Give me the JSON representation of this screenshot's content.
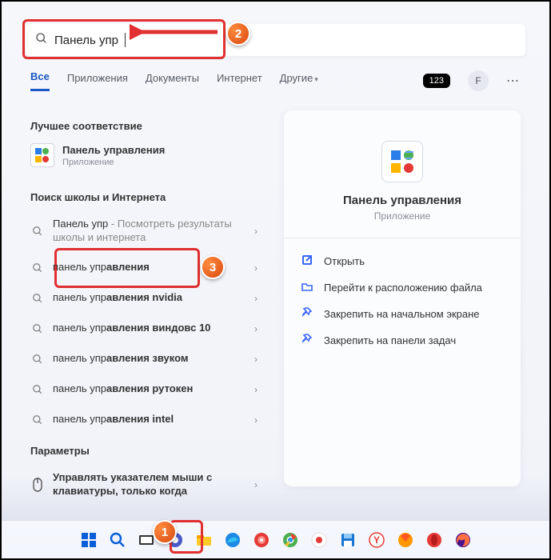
{
  "search": {
    "value": "Панель упр"
  },
  "tabs": {
    "items": [
      "Все",
      "Приложения",
      "Документы",
      "Интернет",
      "Другие"
    ],
    "active_index": 0
  },
  "badges": {
    "pill": "123",
    "avatar": "F"
  },
  "left": {
    "best_header": "Лучшее соответствие",
    "best": {
      "title": "Панель управления",
      "subtitle": "Приложение"
    },
    "web_header": "Поиск школы и Интернета",
    "web_items": [
      {
        "pre": "Панель упр",
        "bold": "",
        "post": "",
        "extra": " - Посмотреть результаты школы и интернета"
      },
      {
        "pre": "панель упр",
        "bold": "авления",
        "post": ""
      },
      {
        "pre": "панель упр",
        "bold": "авления nvidia",
        "post": ""
      },
      {
        "pre": "панель упр",
        "bold": "авления виндовс 10",
        "post": ""
      },
      {
        "pre": "панель упр",
        "bold": "авления звуком",
        "post": ""
      },
      {
        "pre": "панель упр",
        "bold": "авления рутокен",
        "post": ""
      },
      {
        "pre": "панель упр",
        "bold": "авления intel",
        "post": ""
      }
    ],
    "settings_header": "Параметры",
    "settings_item": "Управлять указателем мыши с клавиатуры, только когда"
  },
  "right": {
    "title": "Панель управления",
    "subtitle": "Приложение",
    "actions": [
      {
        "icon": "open",
        "label": "Открыть"
      },
      {
        "icon": "folder",
        "label": "Перейти к расположению файла"
      },
      {
        "icon": "pin",
        "label": "Закрепить на начальном экране"
      },
      {
        "icon": "pin",
        "label": "Закрепить на панели задач"
      }
    ]
  },
  "annotations": {
    "b1": "1",
    "b2": "2",
    "b3": "3"
  }
}
